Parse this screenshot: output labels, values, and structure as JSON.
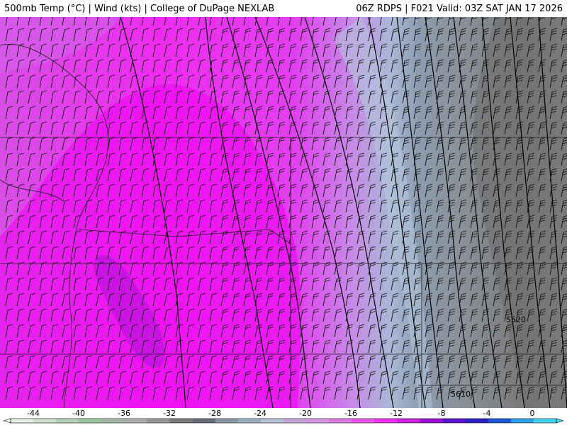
{
  "header": {
    "left": "500mb Temp (°C) | Wind (kts) | College of DuPage NEXLAB",
    "right": "06Z RDPS | F021 Valid: 03Z SAT JAN 17 2026"
  },
  "map": {
    "contour_labels": [
      "5520",
      "5610"
    ]
  },
  "legend": {
    "ticks": [
      "-44",
      "-40",
      "-36",
      "-32",
      "-28",
      "-24",
      "-20",
      "-16",
      "-12",
      "-8",
      "-4",
      "0"
    ],
    "colors": [
      "#e6f2e6",
      "#cfe3cf",
      "#b6d3b6",
      "#9ec69e",
      "#a7b9a7",
      "#b0b0b0",
      "#9a9a9a",
      "#7b7b7b",
      "#666e7a",
      "#8899aa",
      "#9fb3c8",
      "#b3c6dc",
      "#c9a8dc",
      "#d69ae0",
      "#e07be8",
      "#ea55ee",
      "#f230f4",
      "#d020e0",
      "#9a10d8",
      "#5a12d0",
      "#2a20c8",
      "#1e55d8",
      "#2ea0e8",
      "#44d8f0"
    ]
  }
}
